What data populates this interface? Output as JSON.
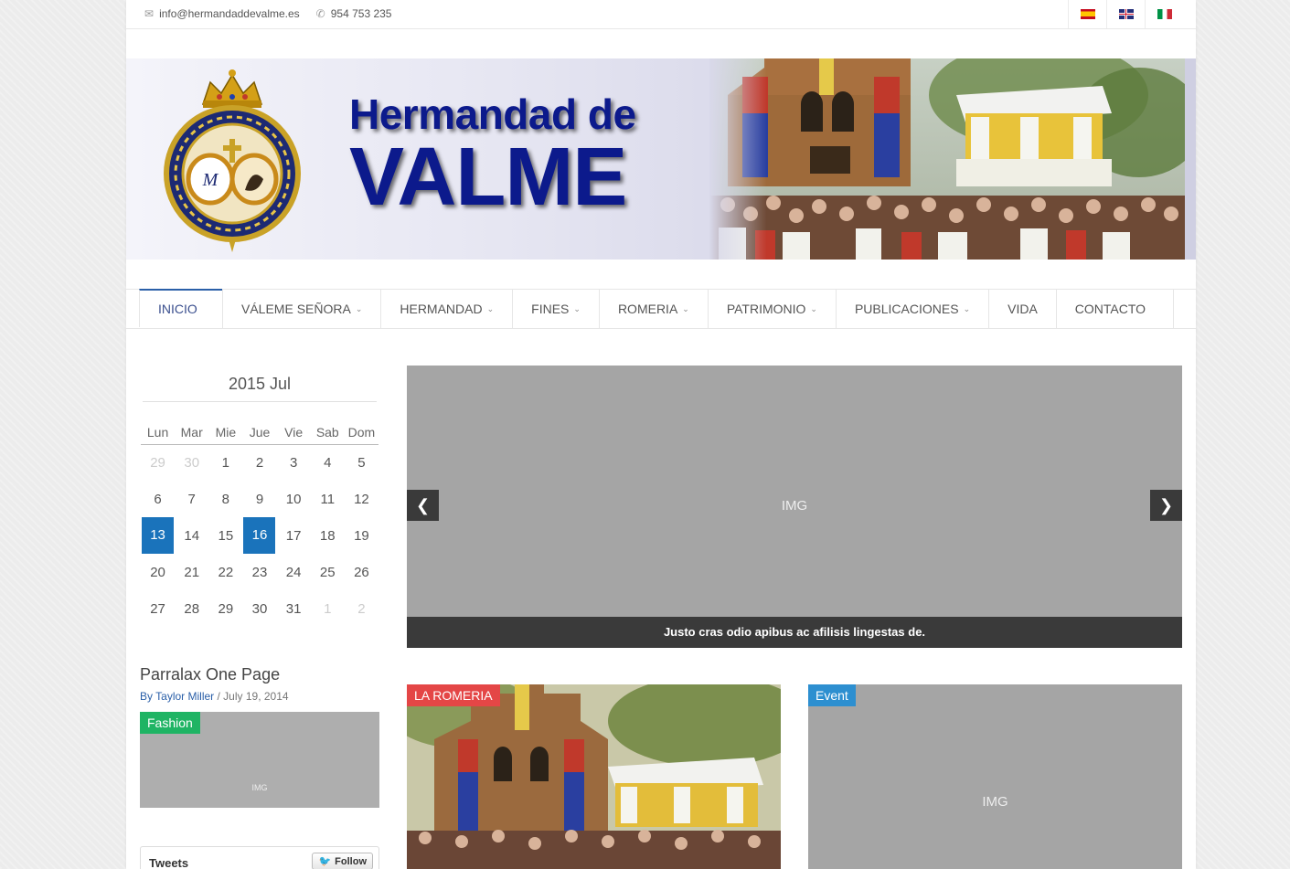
{
  "topbar": {
    "email": "info@hermandaddevalme.es",
    "phone": "954 753 235",
    "email_icon": "envelope-icon",
    "phone_icon": "phone-icon",
    "languages": [
      {
        "code": "es",
        "icon": "spain-flag-icon"
      },
      {
        "code": "en",
        "icon": "uk-flag-icon"
      },
      {
        "code": "it",
        "icon": "italy-flag-icon"
      }
    ]
  },
  "banner": {
    "title_line1": "Hermandad de",
    "title_line2": "VALME"
  },
  "nav": {
    "items": [
      {
        "label": "INICIO",
        "active": true,
        "dropdown": false
      },
      {
        "label": "VÁLEME SEÑORA",
        "dropdown": true
      },
      {
        "label": "HERMANDAD",
        "dropdown": true
      },
      {
        "label": "FINES",
        "dropdown": true
      },
      {
        "label": "ROMERIA",
        "dropdown": true
      },
      {
        "label": "PATRIMONIO",
        "dropdown": true
      },
      {
        "label": "PUBLICACIONES",
        "dropdown": true
      },
      {
        "label": "VIDA",
        "dropdown": false
      },
      {
        "label": "CONTACTO",
        "dropdown": false
      }
    ]
  },
  "calendar": {
    "title": "2015 Jul",
    "weekdays": [
      "Lun",
      "Mar",
      "Mie",
      "Jue",
      "Vie",
      "Sab",
      "Dom"
    ],
    "weeks": [
      [
        "29",
        "30",
        "1",
        "2",
        "3",
        "4",
        "5"
      ],
      [
        "6",
        "7",
        "8",
        "9",
        "10",
        "11",
        "12"
      ],
      [
        "13",
        "14",
        "15",
        "16",
        "17",
        "18",
        "19"
      ],
      [
        "20",
        "21",
        "22",
        "23",
        "24",
        "25",
        "26"
      ],
      [
        "27",
        "28",
        "29",
        "30",
        "31",
        "1",
        "2"
      ]
    ]
  },
  "sidebar_post": {
    "title": "Parralax One Page",
    "by": "By",
    "author": "Taylor Miller",
    "date": "/ July 19, 2014",
    "tag": "Fashion",
    "image_label": "IMG"
  },
  "tweets": {
    "title": "Tweets",
    "follow_label": "Follow",
    "follow_icon": "twitter-bird-icon"
  },
  "slider": {
    "image_label": "IMG",
    "caption": "Justo cras odio apibus ac afilisis lingestas de.",
    "prev_icon": "chevron-left-icon",
    "next_icon": "chevron-right-icon"
  },
  "cards": [
    {
      "tag": "LA ROMERIA",
      "tag_color": "#e44646"
    },
    {
      "tag": "Event",
      "tag_color": "#2d8fd0",
      "image_label": "IMG"
    }
  ],
  "colors": {
    "accent": "#1a73bb",
    "banner_text": "#0c1a8c",
    "nav_active": "#3a4f8e"
  }
}
